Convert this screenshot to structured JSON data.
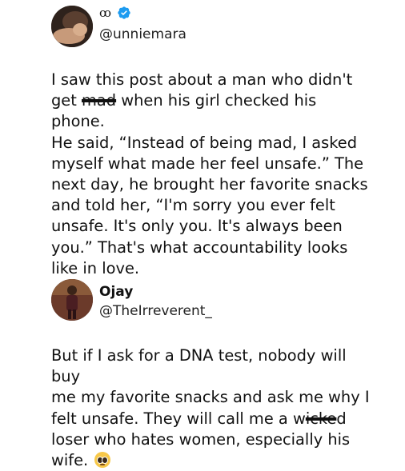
{
  "posts": [
    {
      "display_name": "ꝏ",
      "verified": true,
      "handle": "@unniemara",
      "text_segments": [
        "I saw this post about a man who didn't\nget ",
        "mad",
        " when his girl checked his phone.\nHe said, “Instead of being mad, I asked\nmyself what made her feel unsafe.” The\nnext day, he brought her favorite snacks\nand told her, “I'm sorry you ever felt\nunsafe. It's only you. It's always been\nyou.” That's what accountability looks\nlike in love."
      ]
    },
    {
      "display_name": "Ojay",
      "verified": false,
      "handle": "@TheIrreverent_",
      "text_segments": [
        "But if I ask for a DNA test, nobody will buy\nme my favorite snacks and ask me why I\nfelt unsafe. They will call me a w",
        "icke",
        "d\nloser who hates women, especially his\nwife. "
      ],
      "emoji": "pleading-face"
    }
  ],
  "colors": {
    "verified_badge": "#1d9bf0",
    "text": "#111111"
  }
}
